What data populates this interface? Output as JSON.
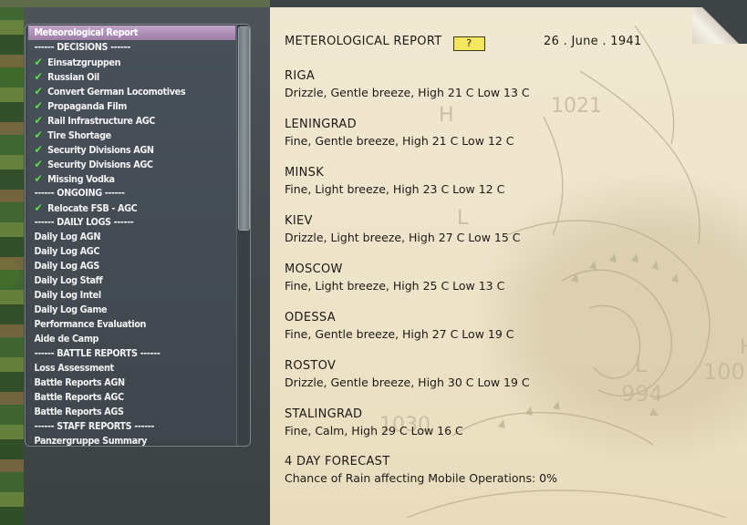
{
  "sidebar": {
    "items": [
      {
        "label": "Meteorological Report",
        "type": "selected"
      },
      {
        "label": "------ DECISIONS ------",
        "type": "header"
      },
      {
        "label": "Einsatzgruppen",
        "type": "checked"
      },
      {
        "label": "Russian Oil",
        "type": "checked"
      },
      {
        "label": "Convert German Locomotives",
        "type": "checked"
      },
      {
        "label": "Propaganda Film",
        "type": "checked"
      },
      {
        "label": "Rail Infrastructure AGC",
        "type": "checked"
      },
      {
        "label": "Tire Shortage",
        "type": "checked"
      },
      {
        "label": "Security Divisions AGN",
        "type": "checked"
      },
      {
        "label": "Security Divisions AGC",
        "type": "checked"
      },
      {
        "label": "Missing Vodka",
        "type": "checked"
      },
      {
        "label": "------ ONGOING ------",
        "type": "header"
      },
      {
        "label": "Relocate FSB - AGC",
        "type": "checked"
      },
      {
        "label": "------ DAILY LOGS ------",
        "type": "header"
      },
      {
        "label": "Daily Log AGN",
        "type": "plain"
      },
      {
        "label": "Daily Log AGC",
        "type": "plain"
      },
      {
        "label": "Daily Log AGS",
        "type": "plain"
      },
      {
        "label": "Daily Log Staff",
        "type": "plain"
      },
      {
        "label": "Daily Log Intel",
        "type": "plain"
      },
      {
        "label": "Daily Log Game",
        "type": "plain"
      },
      {
        "label": "Performance Evaluation",
        "type": "plain"
      },
      {
        "label": "Aide de Camp",
        "type": "plain"
      },
      {
        "label": "------ BATTLE REPORTS ------",
        "type": "header"
      },
      {
        "label": "Loss Assessment",
        "type": "plain"
      },
      {
        "label": "Battle Reports AGN",
        "type": "plain"
      },
      {
        "label": "Battle Reports AGC",
        "type": "plain"
      },
      {
        "label": "Battle Reports AGS",
        "type": "plain"
      },
      {
        "label": "------ STAFF REPORTS ------",
        "type": "header"
      },
      {
        "label": "Panzergruppe Summary",
        "type": "plain"
      }
    ],
    "check_icon": "checkmark-icon",
    "check_color": "#59e045"
  },
  "report": {
    "title": "METEROLOGICAL REPORT",
    "help_label": "?",
    "date": "26 . June . 1941",
    "cities": [
      {
        "name": "RIGA",
        "weather": "Drizzle, Gentle breeze, High 21 C Low 13 C"
      },
      {
        "name": "LENINGRAD",
        "weather": "Fine, Gentle breeze, High 21 C Low 12 C"
      },
      {
        "name": "MINSK",
        "weather": "Fine, Light breeze, High 23 C Low 12 C"
      },
      {
        "name": "KIEV",
        "weather": "Drizzle, Light breeze, High 27 C Low 15 C"
      },
      {
        "name": "MOSCOW",
        "weather": "Fine, Light breeze, High 25 C Low 13 C"
      },
      {
        "name": "ODESSA",
        "weather": "Fine, Gentle breeze, High 27 C Low 19 C"
      },
      {
        "name": "ROSTOV",
        "weather": "Drizzle, Gentle breeze, High 30 C Low 19 C"
      },
      {
        "name": "STALINGRAD",
        "weather": "Fine, Calm, High 29 C Low 16 C"
      }
    ],
    "forecast": {
      "title": "4 DAY FORECAST",
      "text": "Chance of Rain affecting Mobile Operations: 0%"
    },
    "map_labels": [
      "1021",
      "1030",
      "994",
      "100",
      "H",
      "L",
      "L",
      "H"
    ]
  },
  "colors": {
    "paper": "#efe5cc",
    "help_button": "#f4e75e",
    "selected_row": "#a98bb3"
  }
}
